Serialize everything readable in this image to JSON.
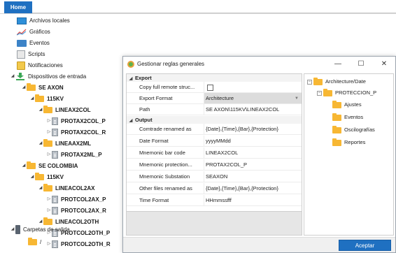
{
  "ribbon": {
    "home_tab": "Home"
  },
  "tree": {
    "items": [
      {
        "label": "Archivos locales",
        "icon": "monitor-icon"
      },
      {
        "label": "Gráficos",
        "icon": "chart-icon"
      },
      {
        "label": "Eventos",
        "icon": "events-icon"
      },
      {
        "label": "Scripts",
        "icon": "script-icon"
      },
      {
        "label": "Notificaciones",
        "icon": "notification-icon"
      },
      {
        "label": "Dispositivos de entrada",
        "icon": "download-icon"
      },
      {
        "label": "SE AXON",
        "icon": "folder-icon"
      },
      {
        "label": "115KV",
        "icon": "folder-icon"
      },
      {
        "label": "LINEAX2COL",
        "icon": "folder-icon"
      },
      {
        "label": "PROTAX2COL_P",
        "icon": "device-file-icon"
      },
      {
        "label": "PROTAX2COL_R",
        "icon": "device-file-icon"
      },
      {
        "label": "LINEAAX2ML",
        "icon": "folder-icon"
      },
      {
        "label": "PROTAX2ML_P",
        "icon": "device-file-icon"
      },
      {
        "label": "SE COLOMBIA",
        "icon": "folder-icon"
      },
      {
        "label": "115KV",
        "icon": "folder-icon"
      },
      {
        "label": "LINEACOL2AX",
        "icon": "folder-icon"
      },
      {
        "label": "PROTCOL2AX_P",
        "icon": "device-file-icon"
      },
      {
        "label": "PROTCOL2AX_R",
        "icon": "device-file-icon"
      },
      {
        "label": "LINEACOL2OTH",
        "icon": "folder-icon"
      },
      {
        "label": "PROTCOL2OTH_P",
        "icon": "device-file-icon"
      },
      {
        "label": "PROTCOL2OTH_R",
        "icon": "device-file-icon"
      },
      {
        "label": "Carpetas de salida",
        "icon": "phone-icon"
      },
      {
        "label": "/",
        "icon": "folder-icon"
      }
    ]
  },
  "dialog": {
    "title": "Gestionar reglas generales",
    "controls": {
      "minimize": "—",
      "maximize": "☐",
      "close": "✕"
    },
    "categories": {
      "export": "Export",
      "output": "Output"
    },
    "export_props": [
      {
        "name": "Copy full remote struc...",
        "value": ""
      },
      {
        "name": "Export Format",
        "value": "Architecture"
      },
      {
        "name": "Path",
        "value": "SE AXON\\115KV\\LINEAX2COL"
      }
    ],
    "output_props": [
      {
        "name": "Comtrade renamed as",
        "value": "{Date},{Time},{Bar},{Protection}"
      },
      {
        "name": "Date Format",
        "value": "yyyyMMdd"
      },
      {
        "name": "Mnemonic bar code",
        "value": "LINEAX2COL"
      },
      {
        "name": "Mnemonic protection...",
        "value": "PROTAX2COL_P"
      },
      {
        "name": "Mnemonic Substation",
        "value": "SEAXON"
      },
      {
        "name": "Other files renamed as",
        "value": "{Date},{Time},{Bar},{Protection}"
      },
      {
        "name": "Time Format",
        "value": "HHmmssfff"
      }
    ],
    "preview": {
      "root": "Architecture/Date",
      "child": "PROTECCION_P",
      "leaves": [
        "Ajustes",
        "Eventos",
        "Oscilografías",
        "Reportes"
      ]
    },
    "accept_label": "Aceptar"
  },
  "colors": {
    "accent": "#1f70c1",
    "folder": "#f7b733"
  }
}
